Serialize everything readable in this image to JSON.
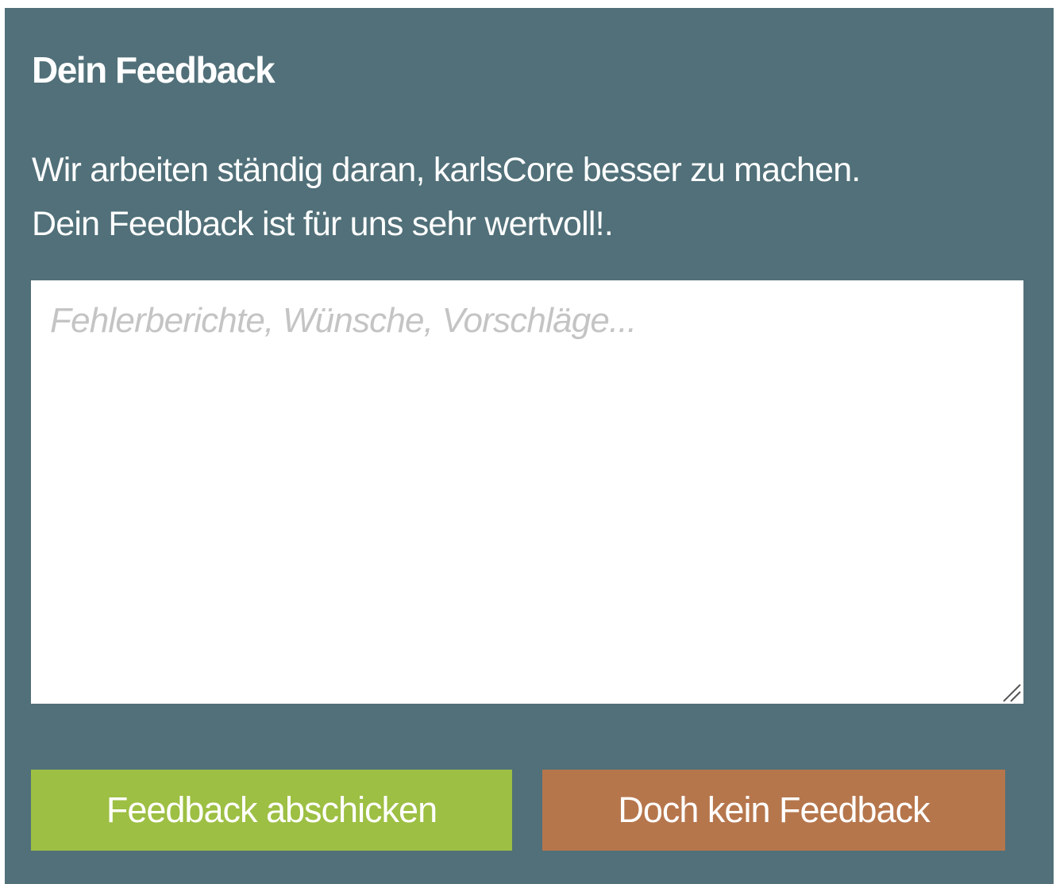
{
  "feedback": {
    "title": "Dein Feedback",
    "description_lines": [
      "Wir arbeiten ständig daran, karlsCore besser zu machen.",
      "Dein Feedback ist für uns sehr wertvoll!."
    ],
    "textarea": {
      "value": "",
      "placeholder": "Fehlerberichte, Wünsche, Vorschläge..."
    },
    "submit_label": "Feedback abschicken",
    "cancel_label": "Doch kein Feedback",
    "icons": {
      "resize_grip": "resize-grip-icon"
    },
    "colors": {
      "panel_background": "#517079",
      "submit_button": "#9dbf43",
      "cancel_button": "#b6764c",
      "text": "#ffffff",
      "placeholder": "#c4c4c4"
    }
  }
}
